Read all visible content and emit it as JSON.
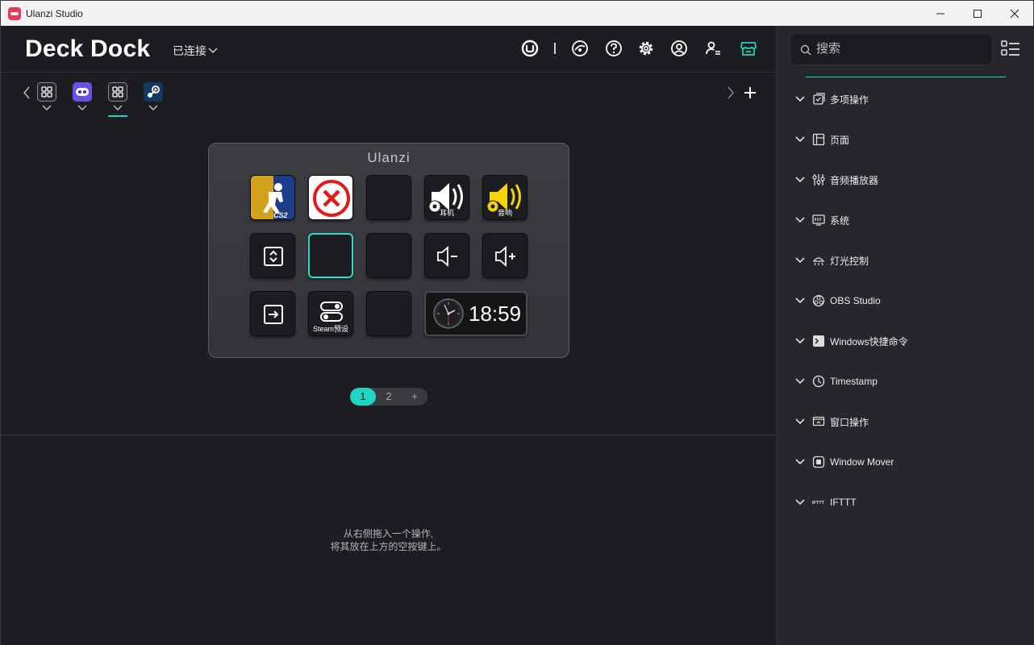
{
  "titlebar": {
    "app_title": "Ulanzi Studio",
    "minimize_icon": "minimize-icon",
    "maximize_icon": "maximize-icon",
    "close_icon": "close-icon"
  },
  "header": {
    "brand": "Deck Dock",
    "connection_status": "已连接",
    "icons": [
      "ulanzi-logo-icon",
      "theme-palette-icon",
      "help-icon",
      "settings-gear-icon",
      "account-icon",
      "user-management-icon",
      "store-icon"
    ],
    "accent_color": "#1fd6c4"
  },
  "profiles": {
    "items": [
      {
        "name": "grid-profile",
        "icon": "grid-icon"
      },
      {
        "name": "bot-profile",
        "icon": "robot-app-icon"
      },
      {
        "name": "grid-profile-active",
        "icon": "grid-icon"
      },
      {
        "name": "steam-profile",
        "icon": "steam-icon"
      }
    ],
    "active_index": 2
  },
  "deck": {
    "brand": "Ulanzi",
    "keys": [
      {
        "row": 0,
        "col": 0,
        "kind": "cs2",
        "label": "CS2"
      },
      {
        "row": 0,
        "col": 1,
        "kind": "close-x",
        "label": ""
      },
      {
        "row": 0,
        "col": 2,
        "kind": "empty",
        "label": ""
      },
      {
        "row": 0,
        "col": 3,
        "kind": "speaker-gear-white",
        "label": "耳机"
      },
      {
        "row": 0,
        "col": 4,
        "kind": "speaker-gear-yellow",
        "label": "音响"
      },
      {
        "row": 1,
        "col": 0,
        "kind": "page-switch",
        "label": ""
      },
      {
        "row": 1,
        "col": 1,
        "kind": "empty-selected",
        "label": ""
      },
      {
        "row": 1,
        "col": 2,
        "kind": "empty",
        "label": ""
      },
      {
        "row": 1,
        "col": 3,
        "kind": "volume-down",
        "label": ""
      },
      {
        "row": 1,
        "col": 4,
        "kind": "volume-up",
        "label": ""
      },
      {
        "row": 2,
        "col": 0,
        "kind": "enter-folder",
        "label": ""
      },
      {
        "row": 2,
        "col": 1,
        "kind": "toggle",
        "label": "Steam预设"
      },
      {
        "row": 2,
        "col": 2,
        "kind": "empty",
        "label": ""
      }
    ],
    "clock": {
      "time": "18:59"
    }
  },
  "pager": {
    "pages": [
      "1",
      "2"
    ],
    "add_label": "+",
    "active": "1"
  },
  "hint": {
    "line1": "从右侧拖入一个操作,",
    "line2": "将其放在上方的空按键上。"
  },
  "panel": {
    "search_placeholder": "搜索",
    "categories": [
      {
        "label": "多项操作",
        "icon": "multi-action-icon"
      },
      {
        "label": "页面",
        "icon": "page-icon"
      },
      {
        "label": "音频播放器",
        "icon": "audio-mixer-icon"
      },
      {
        "label": "系统",
        "icon": "system-icon"
      },
      {
        "label": "灯光控制",
        "icon": "light-icon"
      },
      {
        "label": "OBS Studio",
        "icon": "obs-icon"
      },
      {
        "label": "Windows快捷命令",
        "icon": "terminal-icon"
      },
      {
        "label": "Timestamp",
        "icon": "clock-icon"
      },
      {
        "label": "窗口操作",
        "icon": "window-icon"
      },
      {
        "label": "Window Mover",
        "icon": "window-mover-icon"
      },
      {
        "label": "IFTTT",
        "icon": "ifttt-icon"
      }
    ]
  }
}
